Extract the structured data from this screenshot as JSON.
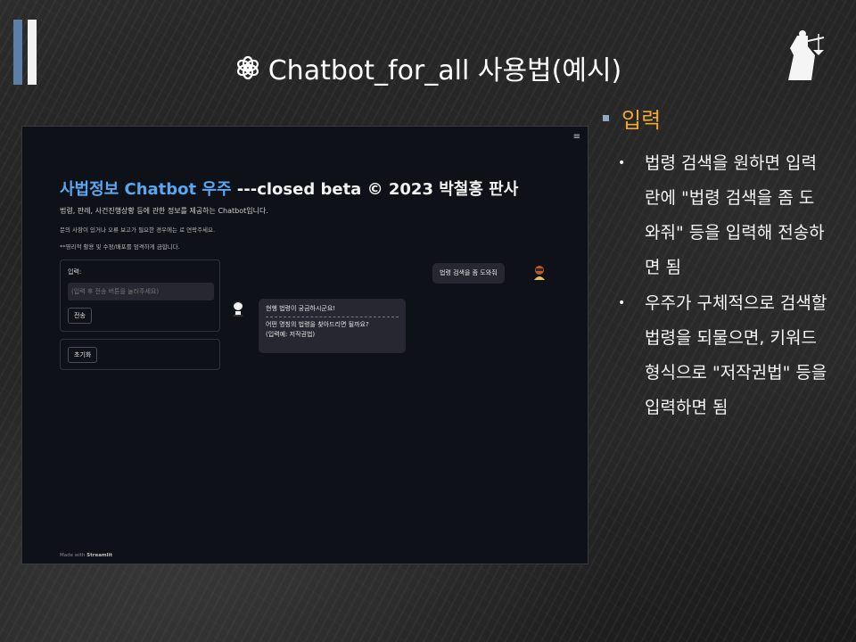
{
  "slide": {
    "title": "Chatbot_for_all 사용법(예시)",
    "accent_colors": {
      "bar_blue": "#5b7fa6",
      "bar_white": "#f2f2f2",
      "section_orange": "#f0a830",
      "app_blue": "#5aa7f0"
    }
  },
  "app": {
    "menu_icon": "≡",
    "title_blue": "사법정보 Chatbot 우주",
    "title_white": " ---closed beta © 2023 박철홍 판사",
    "desc": "법령, 판례, 사건진행상황 등에 관한 정보를 제공하는 Chatbot입니다.",
    "contact": "문의 사항이 있거나 오류 보고가 필요한 경우에는                              로 연락주세요.",
    "notice": "**영리적 활용 및 수정/배포를 엄격하게 금합니다.",
    "input_label": "입력:",
    "input_placeholder": "(입력 후 전송 버튼을 눌러주세요)",
    "send_label": "전송",
    "reset_label": "초기화",
    "user_message": "법령 검색을 좀 도와줘",
    "bot_line1": "현행 법령이 궁금하시군요!",
    "bot_line2": "어떤 명칭의 법령을 찾아드리면 될까요?",
    "bot_line3": "(입력예: 저작권법)",
    "footer_prefix": "Made with ",
    "footer_brand": "Streamlit"
  },
  "notes": {
    "section_title": "입력",
    "bullets": [
      {
        "marker": "•",
        "text": "법령 검색을 원하면 입력란에 \"법령 검색을 좀 도와줘\" 등을 입력해 전송하면 됨"
      },
      {
        "marker": "•",
        "text": "우주가 구체적으로 검색할 법령을 되물으면, 키워드 형식으로 \"저작권법\" 등을 입력하면 됨"
      }
    ]
  }
}
